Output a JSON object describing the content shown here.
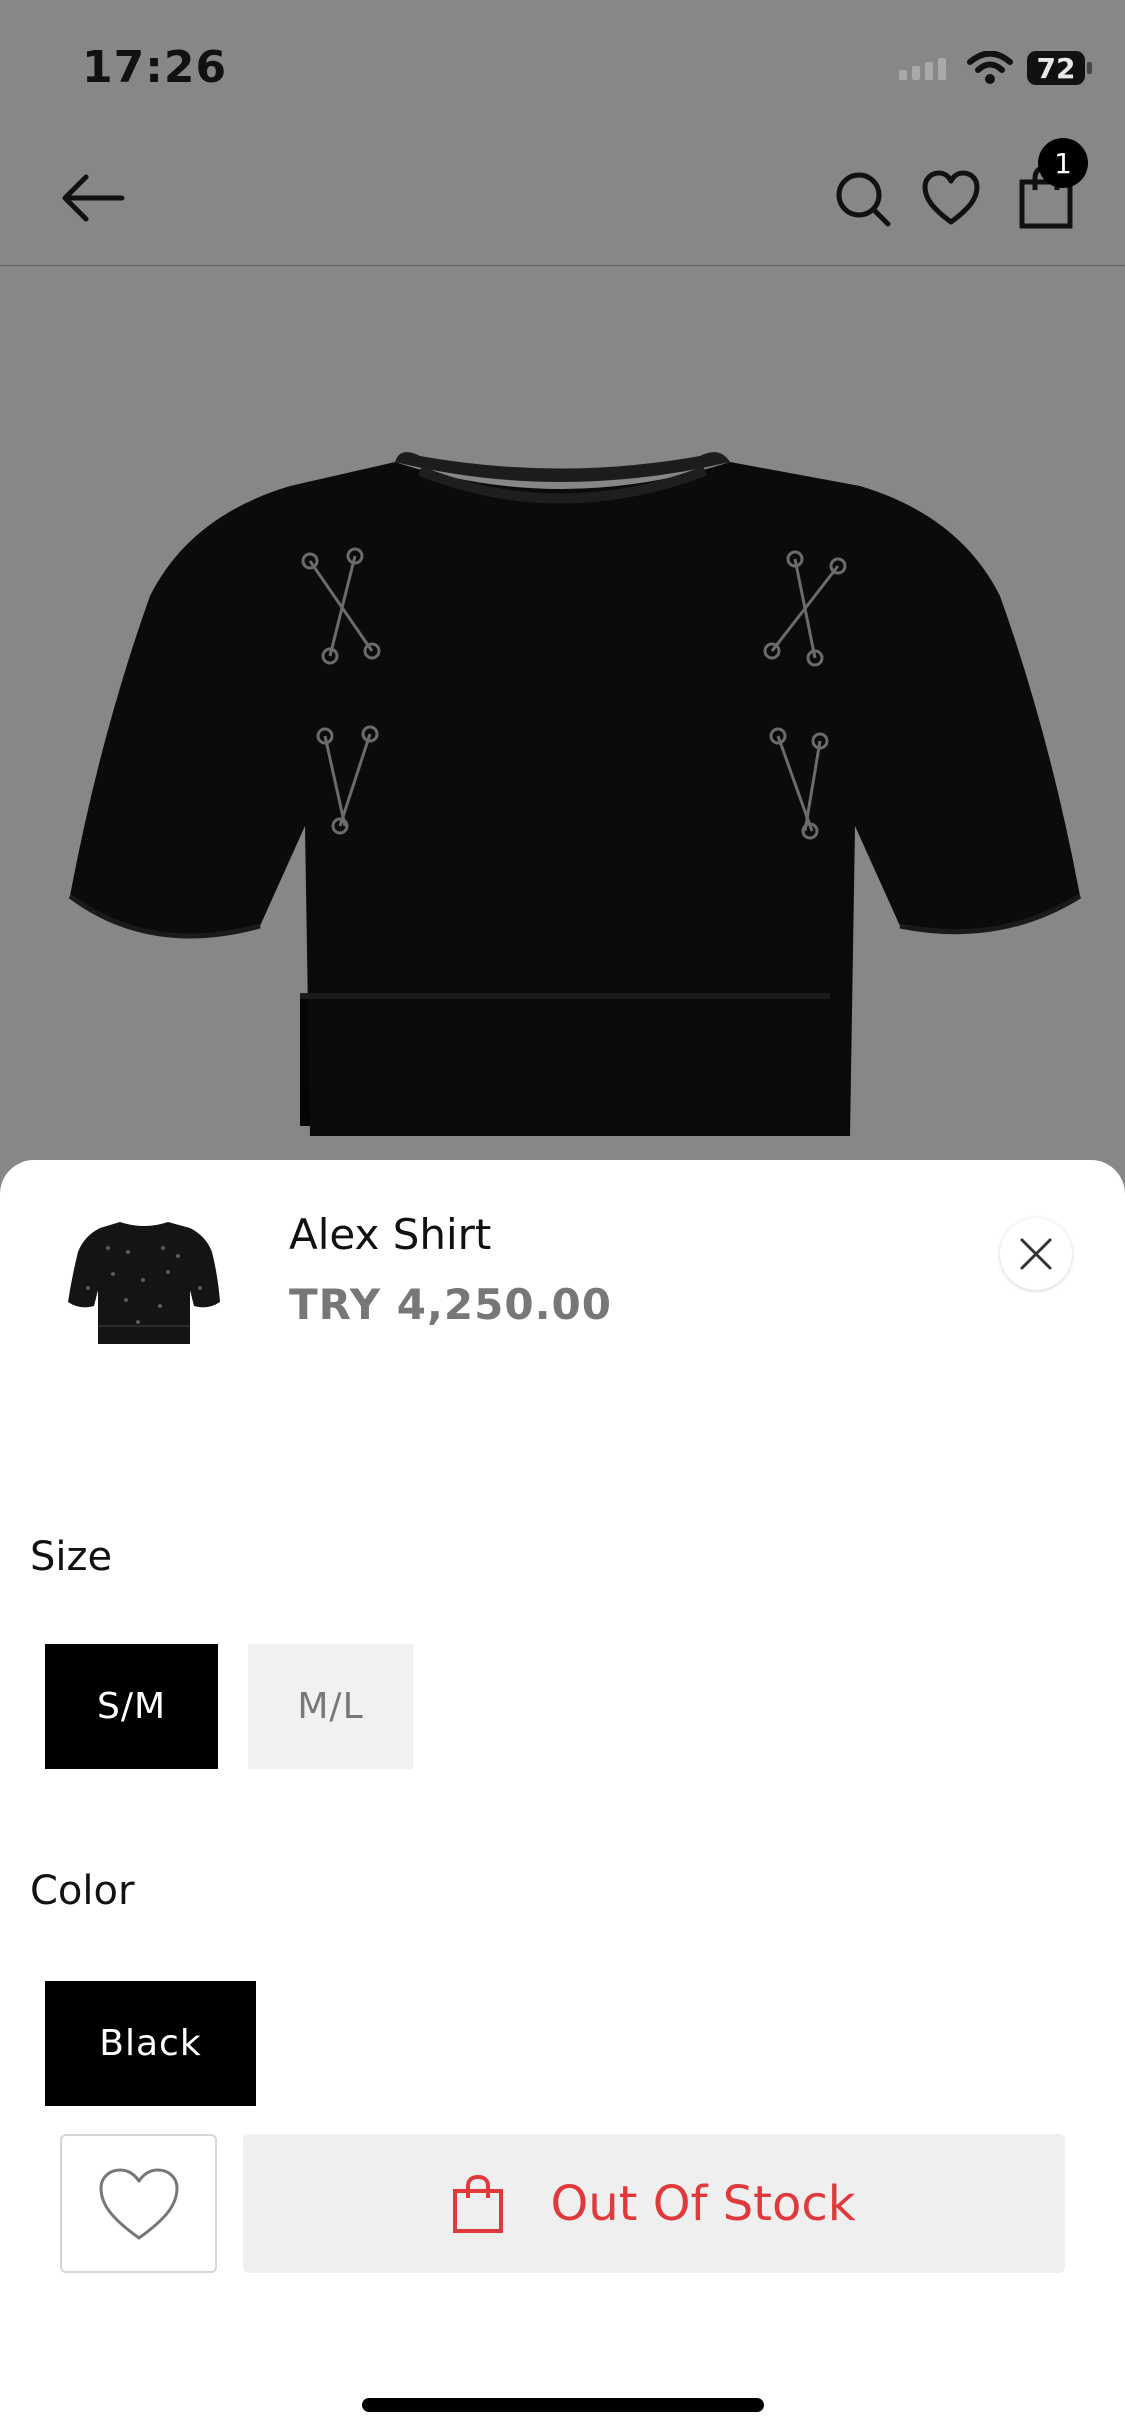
{
  "status_bar": {
    "time": "17:26",
    "battery": "72"
  },
  "header": {
    "cart_count": "1"
  },
  "product": {
    "name": "Alex Shirt",
    "price": "TRY 4,250.00"
  },
  "options": {
    "size_label": "Size",
    "sizes": [
      {
        "label": "S/M",
        "selected": true
      },
      {
        "label": "M/L",
        "selected": false
      }
    ],
    "color_label": "Color",
    "colors": [
      {
        "label": "Black",
        "selected": true
      }
    ]
  },
  "actions": {
    "stock_label": "Out Of Stock"
  },
  "colors": {
    "overlay": "#878787",
    "accent_red": "#e0393b",
    "selected_chip": "#000000"
  }
}
